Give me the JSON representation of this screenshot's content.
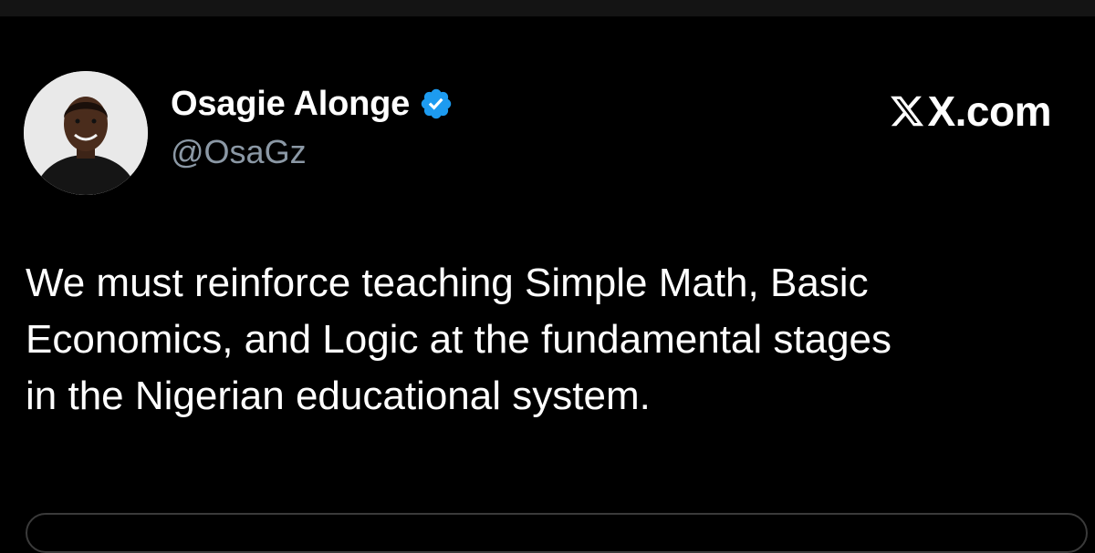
{
  "tweet": {
    "author": {
      "display_name": "Osagie Alonge",
      "handle": "@OsaGz",
      "verified": true,
      "avatar_icon": "person-avatar"
    },
    "brand": {
      "icon": "x-logo-icon",
      "text": "X.com"
    },
    "text": "We must reinforce teaching Simple Math, Basic\nEconomics, and Logic at the fundamental stages\nin the Nigerian educational system."
  },
  "colors": {
    "background": "#000000",
    "text": "#ffffff",
    "handle": "#8b98a5",
    "verified": "#1d9bf0"
  }
}
